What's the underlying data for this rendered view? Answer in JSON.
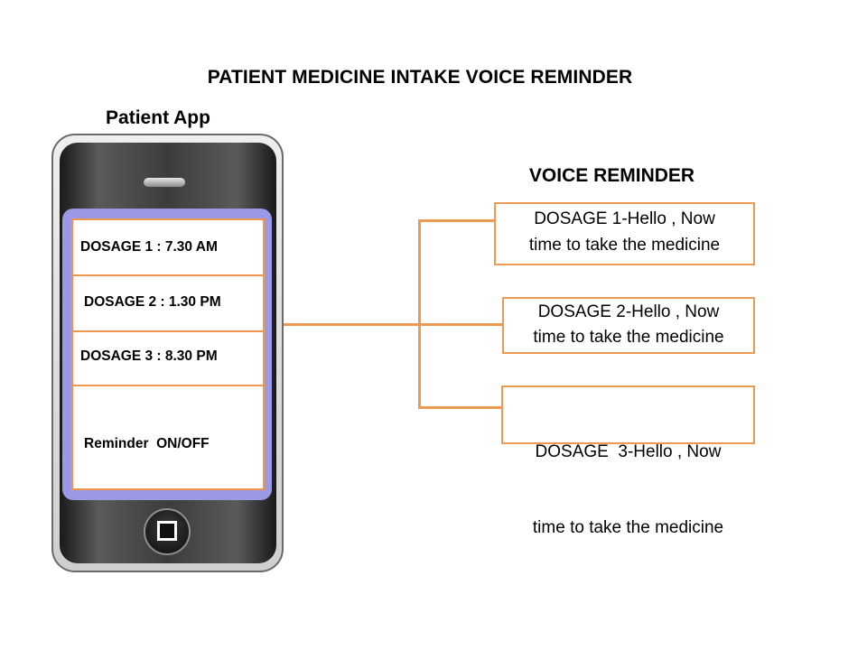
{
  "header": {
    "main_title": "PATIENT MEDICINE INTAKE VOICE REMINDER",
    "app_title": "Patient App",
    "voice_title": "VOICE REMINDER"
  },
  "phone": {
    "rows": [
      {
        "label": "DOSAGE 1 : 7.30 AM"
      },
      {
        "label": "DOSAGE 2 : 1.30 PM"
      },
      {
        "label": "DOSAGE 3 : 8.30 PM"
      },
      {
        "label": "Reminder  ON/OFF"
      }
    ]
  },
  "reminders": [
    {
      "line1": "DOSAGE 1-Hello , Now",
      "line2": "time to take the medicine"
    },
    {
      "line1": "DOSAGE 2-Hello , Now",
      "line2": "time to take the medicine"
    },
    {
      "line1": "DOSAGE  3-Hello , Now",
      "line2": "time to take the medicine"
    }
  ],
  "colors": {
    "accent_orange": "#ec9a52",
    "screen_frame": "#9b99e6",
    "phone_body": "#3c3c3c"
  }
}
